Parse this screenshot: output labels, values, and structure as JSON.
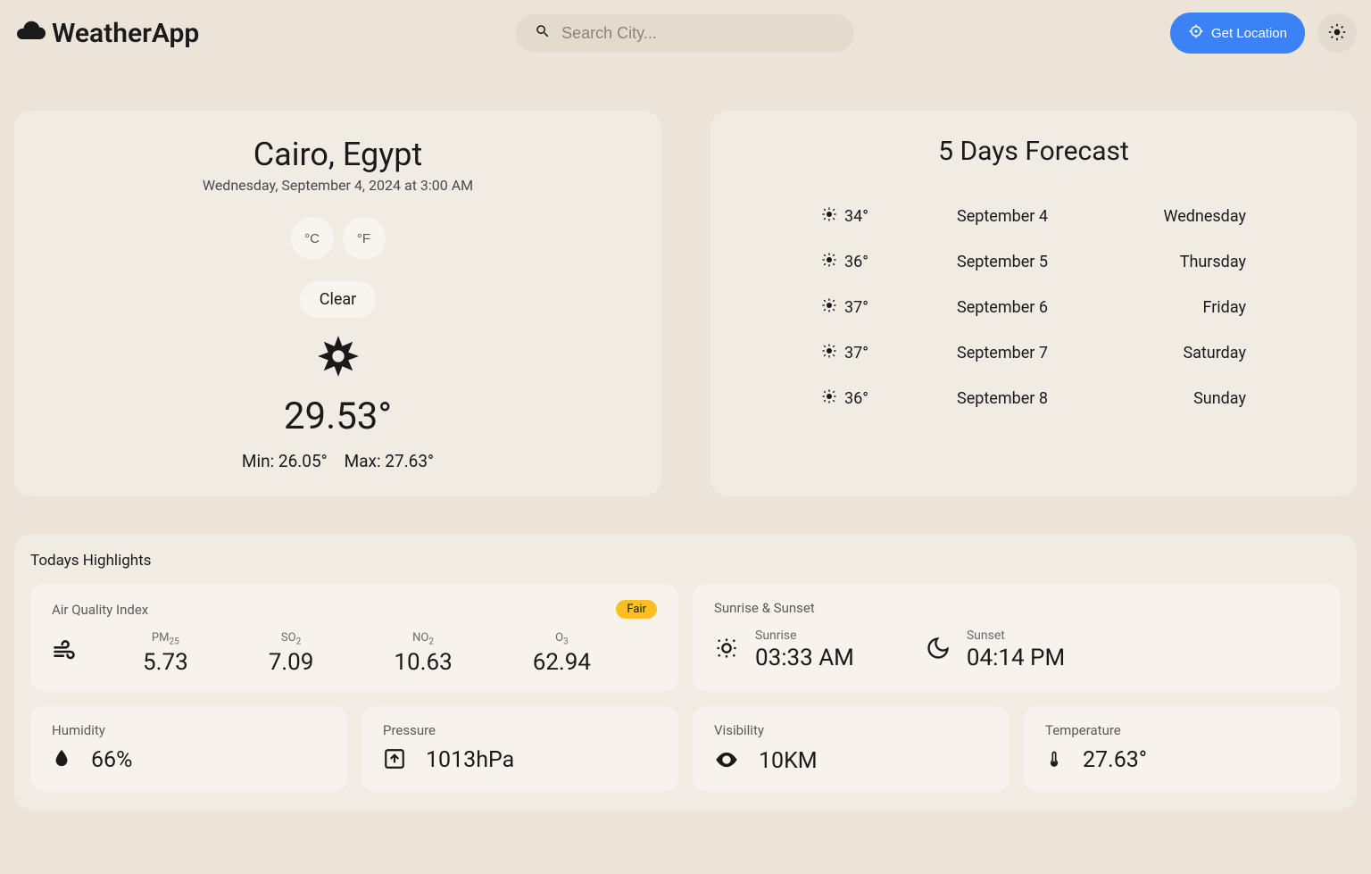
{
  "app": {
    "name": "WeatherApp"
  },
  "header": {
    "search_placeholder": "Search City...",
    "get_location_label": "Get Location"
  },
  "current": {
    "city": "Cairo, Egypt",
    "datetime": "Wednesday, September 4, 2024 at 3:00 AM",
    "unit_c": "°C",
    "unit_f": "°F",
    "condition": "Clear",
    "temp": "29.53°",
    "min_label": "Min:",
    "min_value": "26.05°",
    "max_label": "Max:",
    "max_value": "27.63°"
  },
  "forecast": {
    "title": "5 Days Forecast",
    "days": [
      {
        "temp": "34°",
        "date": "September 4",
        "day": "Wednesday"
      },
      {
        "temp": "36°",
        "date": "September 5",
        "day": "Thursday"
      },
      {
        "temp": "37°",
        "date": "September 6",
        "day": "Friday"
      },
      {
        "temp": "37°",
        "date": "September 7",
        "day": "Saturday"
      },
      {
        "temp": "36°",
        "date": "September 8",
        "day": "Sunday"
      }
    ]
  },
  "highlights": {
    "title": "Todays Highlights",
    "aqi": {
      "label": "Air Quality Index",
      "badge": "Fair",
      "items": [
        {
          "label": "PM",
          "sub": "25",
          "value": "5.73"
        },
        {
          "label": "SO",
          "sub": "2",
          "value": "7.09"
        },
        {
          "label": "NO",
          "sub": "2",
          "value": "10.63"
        },
        {
          "label": "O",
          "sub": "3",
          "value": "62.94"
        }
      ]
    },
    "sun": {
      "label": "Sunrise & Sunset",
      "sunrise_label": "Sunrise",
      "sunrise_value": "03:33 AM",
      "sunset_label": "Sunset",
      "sunset_value": "04:14 PM"
    },
    "humidity": {
      "label": "Humidity",
      "value": "66%"
    },
    "pressure": {
      "label": "Pressure",
      "value": "1013hPa"
    },
    "visibility": {
      "label": "Visibility",
      "value": "10KM"
    },
    "temperature": {
      "label": "Temperature",
      "value": "27.63°"
    }
  }
}
